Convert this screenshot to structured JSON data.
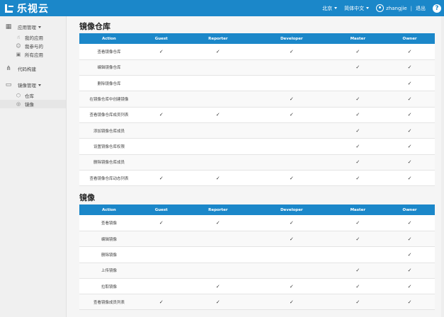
{
  "topbar": {
    "brand": "乐视云",
    "region": "北京",
    "language": "简体中文",
    "username": "zhangjie",
    "logout": "退出",
    "help": "?"
  },
  "sidebar": {
    "app_mgmt": {
      "label": "应用管理",
      "items": [
        {
          "label": "我的应用",
          "icon": "hand-icon"
        },
        {
          "label": "我参与的",
          "icon": "user-group-icon"
        },
        {
          "label": "所有应用",
          "icon": "apps-icon"
        }
      ]
    },
    "code_build": {
      "label": "代码构建"
    },
    "image_mgmt": {
      "label": "镜像管理",
      "items": [
        {
          "label": "仓库",
          "icon": "cube-icon"
        },
        {
          "label": "镜像",
          "icon": "eye-icon"
        }
      ]
    }
  },
  "columns": [
    "Action",
    "Guest",
    "Reporter",
    "Developer",
    "Master",
    "Owner"
  ],
  "check_mark": "✓",
  "repo_section": {
    "title": "镜像仓库",
    "rows": [
      {
        "action": "查看镜像仓库",
        "perms": [
          true,
          true,
          true,
          true,
          true
        ]
      },
      {
        "action": "编辑镜像仓库",
        "perms": [
          false,
          false,
          false,
          true,
          true
        ]
      },
      {
        "action": "删除镜像仓库",
        "perms": [
          false,
          false,
          false,
          false,
          true
        ]
      },
      {
        "action": "在镜像仓库中创建镜像",
        "perms": [
          false,
          false,
          true,
          true,
          true
        ]
      },
      {
        "action": "查看镜像仓库成员列表",
        "perms": [
          true,
          true,
          true,
          true,
          true
        ]
      },
      {
        "action": "添加镜像仓库成员",
        "perms": [
          false,
          false,
          false,
          true,
          true
        ]
      },
      {
        "action": "设置镜像仓库权限",
        "perms": [
          false,
          false,
          false,
          true,
          true
        ]
      },
      {
        "action": "删除镜像仓库成员",
        "perms": [
          false,
          false,
          false,
          true,
          true
        ]
      },
      {
        "action": "查看镜像仓库动态列表",
        "perms": [
          true,
          true,
          true,
          true,
          true
        ]
      }
    ]
  },
  "image_section": {
    "title": "镜像",
    "rows": [
      {
        "action": "查看镜像",
        "perms": [
          true,
          true,
          true,
          true,
          true
        ]
      },
      {
        "action": "编辑镜像",
        "perms": [
          false,
          false,
          true,
          true,
          true
        ]
      },
      {
        "action": "删除镜像",
        "perms": [
          false,
          false,
          false,
          false,
          true
        ]
      },
      {
        "action": "上传镜像",
        "perms": [
          false,
          false,
          false,
          true,
          true
        ]
      },
      {
        "action": "拉取镜像",
        "perms": [
          false,
          true,
          true,
          true,
          true
        ]
      },
      {
        "action": "查看镜像成员列表",
        "perms": [
          true,
          true,
          true,
          true,
          true
        ]
      }
    ]
  }
}
